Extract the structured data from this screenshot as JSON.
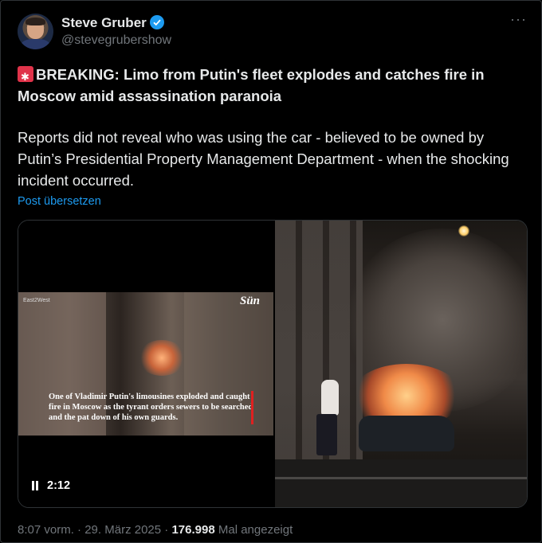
{
  "post": {
    "author_name": "Steve Gruber",
    "handle": "@stevegrubershow",
    "more_label": "···",
    "headline": "BREAKING: Limo from Putin's fleet explodes and catches fire in Moscow amid assassination paranoia",
    "body": "Reports did not reveal who was using the car - believed to be owned by Putin’s Presidential Property Management Department - when the shocking incident occurred.",
    "translate_label": "Post übersetzen"
  },
  "media": {
    "thumb_watermark": "East2West",
    "thumb_brand": "Sün",
    "thumb_caption": "One of Vladimir Putin's limousines exploded and caught fire in Moscow as the tyrant orders sewers to be searched and the pat down of his own guards.",
    "duration": "2:12"
  },
  "meta": {
    "time": "8:07 vorm.",
    "sep1": "·",
    "date": "29. März 2025",
    "sep2": "·",
    "views": "176.998",
    "views_label": "Mal angezeigt"
  },
  "colors": {
    "link": "#1d9bf0",
    "text": "#e7e9ea",
    "muted": "#71767b",
    "background": "#000000"
  },
  "icons": {
    "verified": "verified-badge-icon",
    "siren": "police-siren-icon",
    "pause": "pause-icon"
  }
}
